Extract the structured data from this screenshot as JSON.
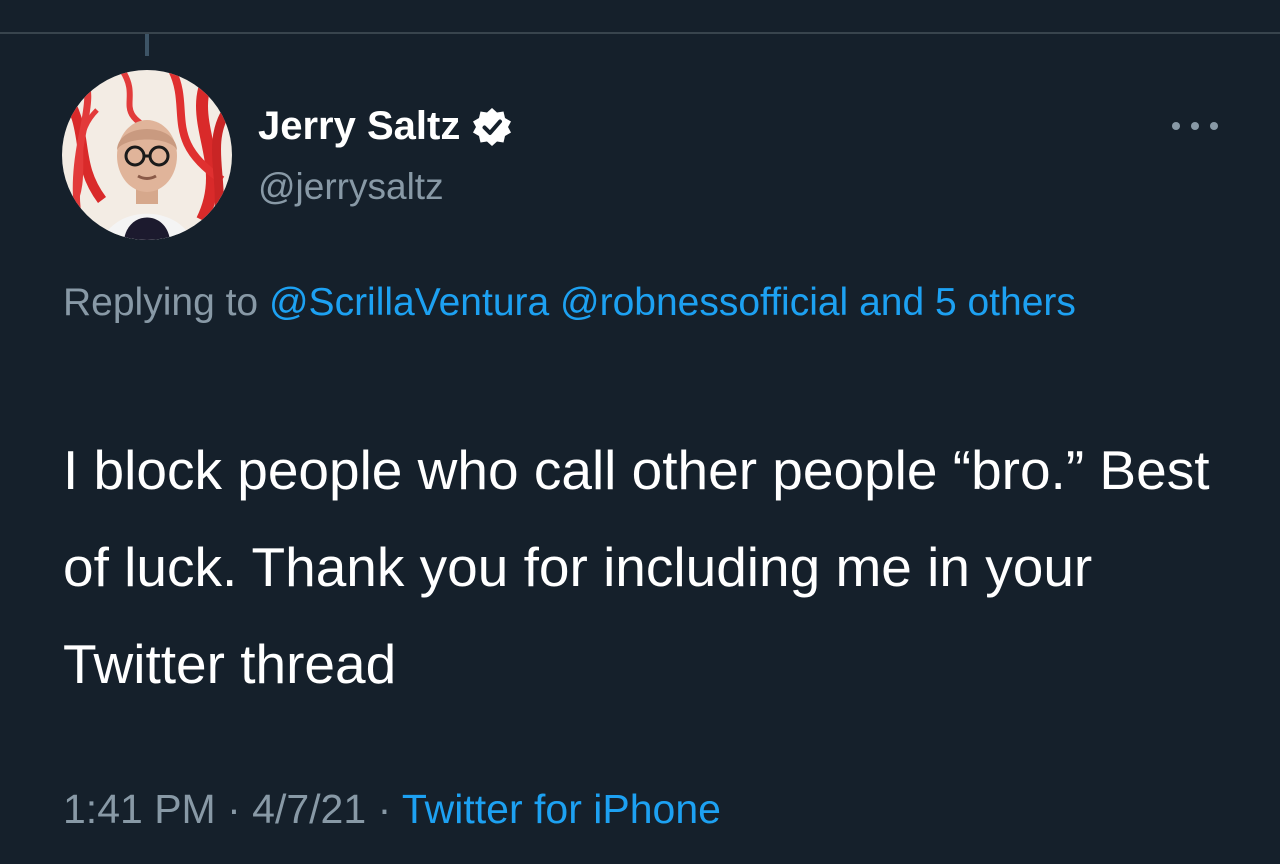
{
  "tweet": {
    "author": {
      "display_name": "Jerry Saltz",
      "handle": "@jerrysaltz",
      "verified": true,
      "avatar_icon": "avatar-photo"
    },
    "reply": {
      "prefix": "Replying to",
      "mention_1": "@ScrillaVentura",
      "mention_2": "@robnessofficial",
      "others": "and 5 others"
    },
    "text": "I block people who call other people “bro.”  Best of luck. Thank you for including me in your Twitter thread",
    "time": "1:41 PM",
    "separator": "·",
    "date": "4/7/21",
    "source": "Twitter for iPhone"
  },
  "colors": {
    "background": "#15202b",
    "text_primary": "#ffffff",
    "text_secondary": "#8899a6",
    "accent": "#1da1f2"
  },
  "icons": {
    "more": "more-horizontal-icon",
    "verified": "verified-badge-icon"
  }
}
